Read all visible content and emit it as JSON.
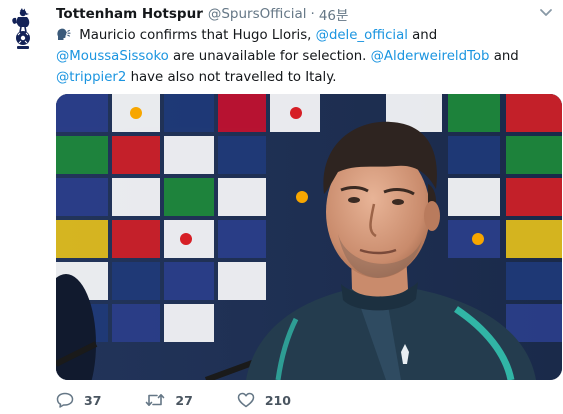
{
  "account": {
    "display_name": "Tottenham Hotspur",
    "handle": "@SpursOfficial",
    "separator": "·",
    "timestamp": "46분"
  },
  "tweet": {
    "seg1": " Mauricio confirms that Hugo Lloris, ",
    "mention1": "@dele_official",
    "seg2": " and ",
    "mention2": "@MoussaSissoko",
    "seg3": " are unavailable for selection. ",
    "mention3": "@AlderweireldTob",
    "seg4": " and ",
    "mention4": "@trippier2",
    "seg5": " have also not travelled to Italy."
  },
  "actions": {
    "reply_count": "37",
    "retweet_count": "27",
    "like_count": "210"
  },
  "icons": {
    "avatar": "spurs-cockerel-logo",
    "emoji": "speaking-head-emoji",
    "reply": "reply-icon",
    "retweet": "retweet-icon",
    "like": "heart-icon",
    "menu": "chevron-down-icon"
  },
  "colors": {
    "link": "#1b95e0",
    "muted": "#657786"
  }
}
